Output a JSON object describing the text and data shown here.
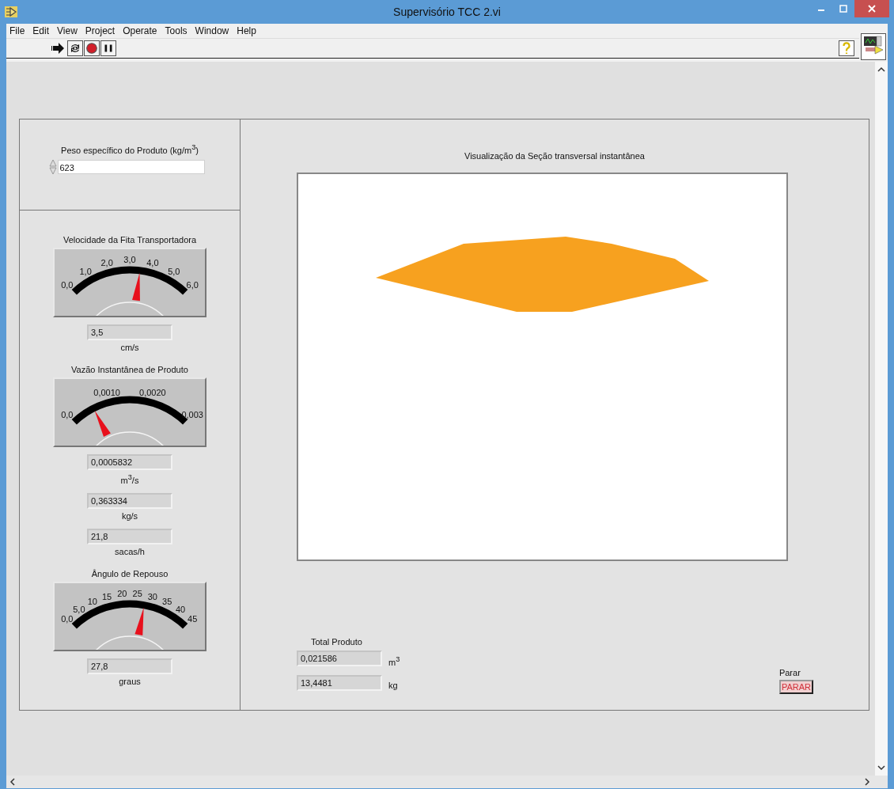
{
  "window": {
    "title": "Supervisório TCC 2.vi"
  },
  "menu": [
    "File",
    "Edit",
    "View",
    "Project",
    "Operate",
    "Tools",
    "Window",
    "Help"
  ],
  "density_control": {
    "label": "Peso específico do Produto (kg/m$^{3}$)",
    "value": "623"
  },
  "gauges": [
    {
      "title": "Velocidade da Fita Transportadora",
      "ticks": [
        "0,0",
        "1,0",
        "2,0",
        "3,0",
        "4,0",
        "5,0",
        "6,0"
      ],
      "readouts": [
        {
          "value": "3,5",
          "unit": "cm/s"
        }
      ]
    },
    {
      "title": "Vazão Instantânea de Produto",
      "ticks": [
        "0,0",
        "0,0010",
        "0,0020",
        "0,003"
      ],
      "readouts": [
        {
          "value": "0,0005832",
          "unit": "m$^{3}$/s"
        },
        {
          "value": "0,363334",
          "unit": "kg/s"
        },
        {
          "value": "21,8",
          "unit": "sacas/h"
        }
      ]
    },
    {
      "title": "Ângulo de Repouso",
      "ticks": [
        "0,0",
        "5,0",
        "10",
        "15",
        "20",
        "25",
        "30",
        "35",
        "40",
        "45"
      ],
      "readouts": [
        {
          "value": "27,8",
          "unit": "graus"
        }
      ]
    }
  ],
  "graph": {
    "title": "Visualização da Seção transversal instantânea"
  },
  "total": {
    "title": "Total Produto",
    "readouts": [
      {
        "value": "0,021586",
        "unit": "m$^{3}$"
      },
      {
        "value": "13,4481",
        "unit": "kg"
      }
    ]
  },
  "stop": {
    "label": "Parar",
    "button": "PARAR"
  }
}
